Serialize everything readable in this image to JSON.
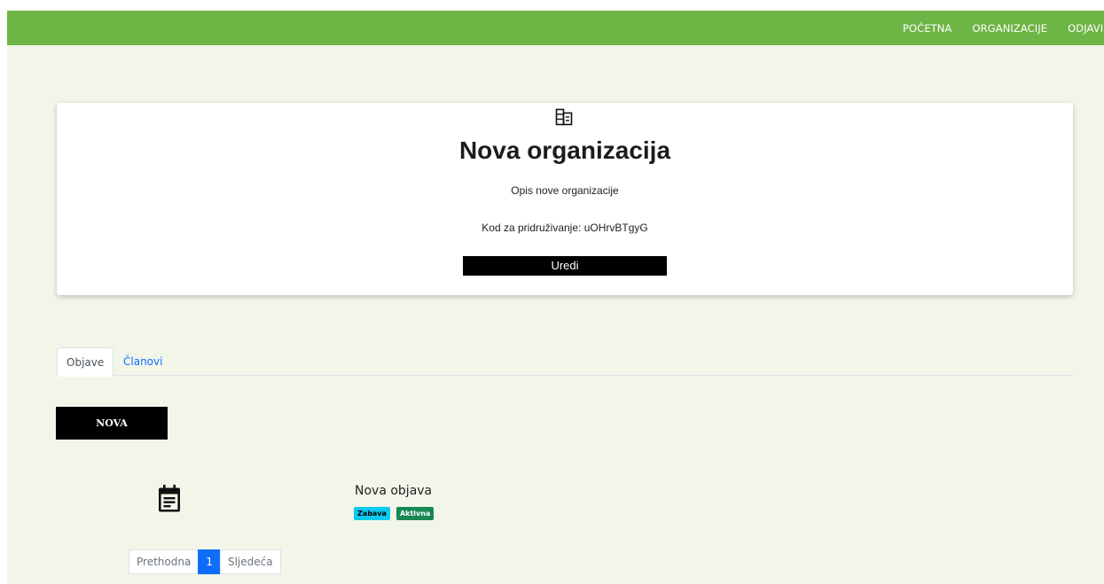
{
  "nav": {
    "links": [
      "POČETNA",
      "ORGANIZACIJE",
      "ODJAVI SE"
    ]
  },
  "organization": {
    "icon": "building-icon",
    "title": "Nova organizacija",
    "description": "Opis nove organizacije",
    "join_code": "Kod za pridruživanje: uOHrvBTgyG",
    "edit_label": "Uredi"
  },
  "tabs": [
    {
      "label": "Objave",
      "active": true
    },
    {
      "label": "Članovi",
      "active": false
    }
  ],
  "new_button_label": "NOVA",
  "posts": [
    {
      "icon": "calendar-icon",
      "title": "Nova objava",
      "category": "Zabava",
      "status": "Aktivna"
    }
  ],
  "pagination": {
    "prev_label": "Prethodna",
    "current_page": "1",
    "next_label": "Sljedeća"
  },
  "colors": {
    "navbar": "#6db544",
    "page_background": "#f2f6e9",
    "badge_category": "#0dcaf0",
    "badge_status": "#198754",
    "pagination_active": "#0d6efd"
  }
}
